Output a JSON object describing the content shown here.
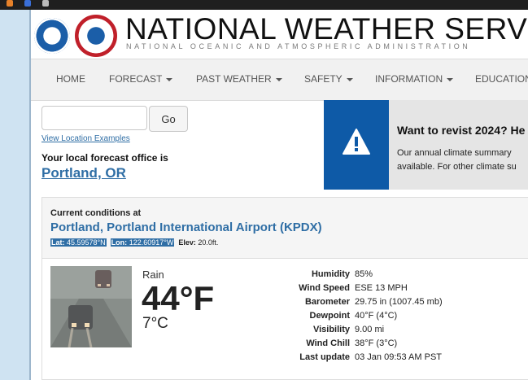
{
  "header": {
    "title": "NATIONAL WEATHER SERVICE",
    "subtitle": "NATIONAL OCEANIC AND ATMOSPHERIC ADMINISTRATION"
  },
  "nav": {
    "items": [
      {
        "label": "HOME",
        "has_dropdown": false
      },
      {
        "label": "FORECAST",
        "has_dropdown": true
      },
      {
        "label": "PAST WEATHER",
        "has_dropdown": true
      },
      {
        "label": "SAFETY",
        "has_dropdown": true
      },
      {
        "label": "INFORMATION",
        "has_dropdown": true
      },
      {
        "label": "EDUCATION",
        "has_dropdown": false
      }
    ]
  },
  "search": {
    "value": "",
    "button_label": "Go",
    "examples_link": "View Location Examples"
  },
  "office": {
    "label": "Your local forecast office is",
    "link": "Portland, OR"
  },
  "banner": {
    "title": "Want to revist 2024? He",
    "text_line1": "Our annual climate summary",
    "text_line2": "available. For other climate su",
    "icon": "warning-triangle-icon",
    "color": "#0e5aa7"
  },
  "current_conditions": {
    "label": "Current conditions at",
    "station": "Portland, Portland International Airport (KPDX)",
    "lat_label": "Lat:",
    "lat_value": "45.59578°N",
    "lon_label": "Lon:",
    "lon_value": "122.60917°W",
    "elev_label": "Elev:",
    "elev_value": "20.0ft.",
    "description": "Rain",
    "temp_f": "44°F",
    "temp_c": "7°C",
    "details": [
      {
        "label": "Humidity",
        "value": "85%"
      },
      {
        "label": "Wind Speed",
        "value": "ESE 13 MPH"
      },
      {
        "label": "Barometer",
        "value": "29.75 in (1007.45 mb)"
      },
      {
        "label": "Dewpoint",
        "value": "40°F (4°C)"
      },
      {
        "label": "Visibility",
        "value": "9.00 mi"
      },
      {
        "label": "Wind Chill",
        "value": "38°F (3°C)"
      },
      {
        "label": "Last update",
        "value": "03 Jan 09:53 AM PST"
      }
    ]
  },
  "colors": {
    "link": "#2f6ea5",
    "nav_bg": "#f1f1f1"
  }
}
